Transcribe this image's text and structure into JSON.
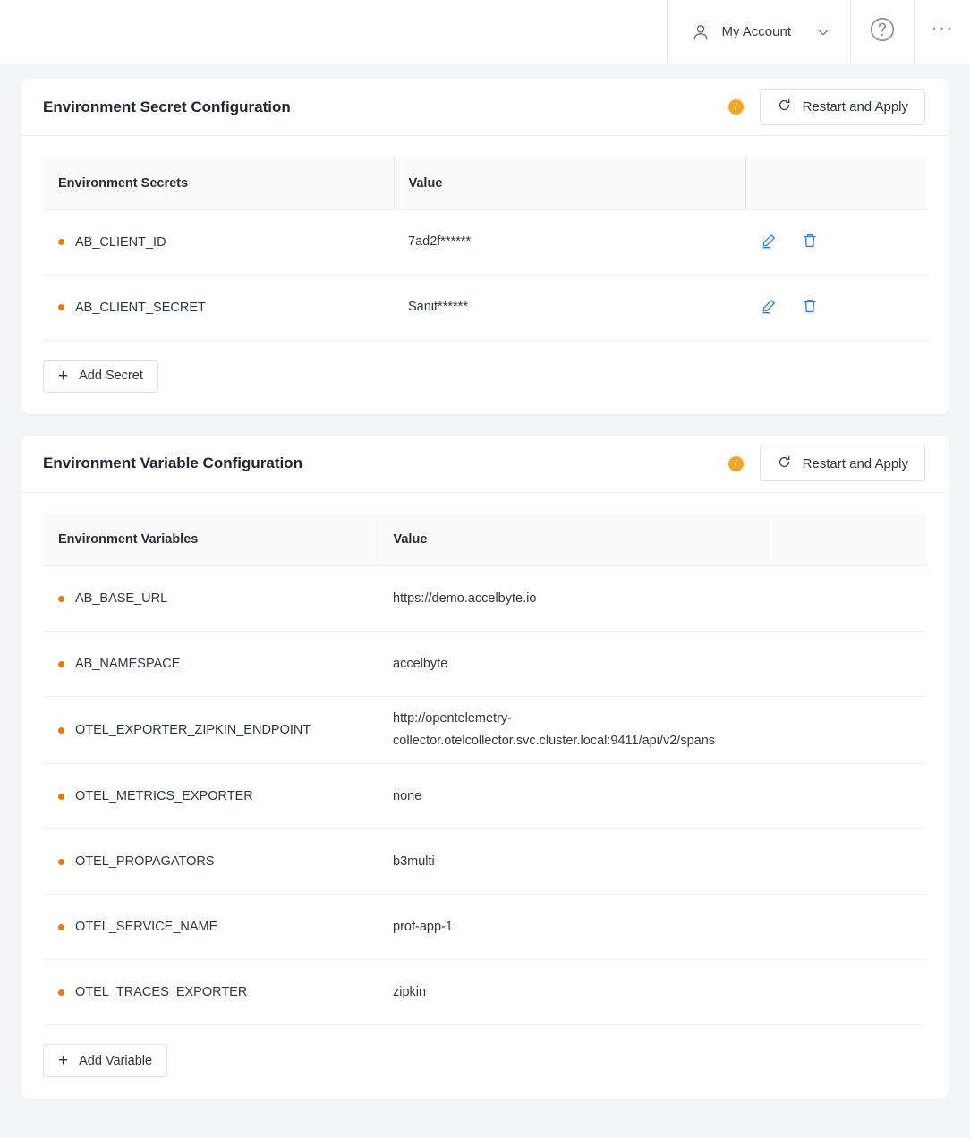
{
  "topbar": {
    "account_label": "My Account",
    "person_icon": "person-icon",
    "chevron_icon": "chevron-down-icon",
    "help_icon": "help-circle-icon",
    "more_icon": "ellipsis-icon"
  },
  "colors": {
    "accent_orange": "#f07800",
    "info_orange": "#f5a623",
    "action_blue": "#2a7bf6",
    "page_bg": "#f4f5f7"
  },
  "secrets_card": {
    "title": "Environment Secret Configuration",
    "info_icon_label": "i",
    "restart_label": "Restart and Apply",
    "restart_icon": "refresh-icon",
    "columns": [
      "Environment Secrets",
      "Value",
      ""
    ],
    "rows": [
      {
        "name": "AB_CLIENT_ID",
        "value": "7ad2f******"
      },
      {
        "name": "AB_CLIENT_SECRET",
        "value": "Sanit******"
      }
    ],
    "add_label": "Add Secret",
    "add_icon": "plus-icon",
    "edit_icon": "pencil-icon",
    "delete_icon": "trash-icon"
  },
  "variables_card": {
    "title": "Environment Variable Configuration",
    "info_icon_label": "i",
    "restart_label": "Restart and Apply",
    "restart_icon": "refresh-icon",
    "columns": [
      "Environment Variables",
      "Value",
      ""
    ],
    "rows": [
      {
        "name": "AB_BASE_URL",
        "value": "https://demo.accelbyte.io"
      },
      {
        "name": "AB_NAMESPACE",
        "value": "accelbyte"
      },
      {
        "name": "OTEL_EXPORTER_ZIPKIN_ENDPOINT",
        "value": "http://opentelemetry-collector.otelcollector.svc.cluster.local:9411/api/v2/spans"
      },
      {
        "name": "OTEL_METRICS_EXPORTER",
        "value": "none"
      },
      {
        "name": "OTEL_PROPAGATORS",
        "value": "b3multi"
      },
      {
        "name": "OTEL_SERVICE_NAME",
        "value": "prof-app-1"
      },
      {
        "name": "OTEL_TRACES_EXPORTER",
        "value": "zipkin"
      }
    ],
    "add_label": "Add Variable",
    "add_icon": "plus-icon"
  }
}
